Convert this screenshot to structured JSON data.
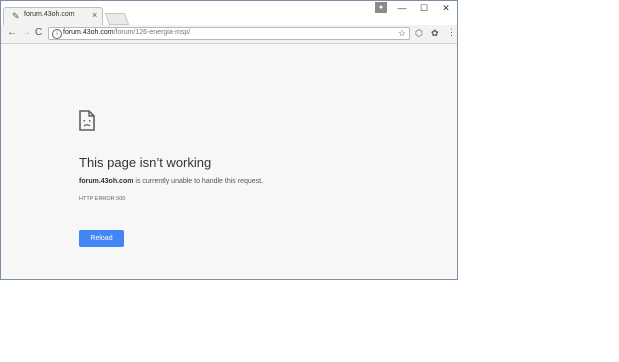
{
  "tab": {
    "title": "forum.43oh.com",
    "close": "×"
  },
  "window_controls": {
    "minimize": "—",
    "maximize": "☐",
    "close": "✕"
  },
  "toolbar": {
    "back": "←",
    "forward": "→",
    "refresh": "C",
    "menu": "⋮"
  },
  "address": {
    "host": "forum.43oh.com",
    "path": "/forum/126-energia-msp/"
  },
  "error": {
    "title": "This page isn’t working",
    "host": "forum.43oh.com",
    "message": " is currently unable to handle this request.",
    "code": "HTTP ERROR 500"
  },
  "reload_button": {
    "label": "Reload"
  },
  "colors": {
    "accent": "#4285f4",
    "page_background": "#f7f7f7"
  },
  "icons": [
    "page-favicon-icon",
    "close-icon",
    "new-tab-icon",
    "profile-icon",
    "minimize-icon",
    "maximize-icon",
    "back-icon",
    "forward-icon",
    "refresh-icon",
    "info-icon",
    "star-icon",
    "extension-icon",
    "menu-icon",
    "sad-document-icon"
  ]
}
